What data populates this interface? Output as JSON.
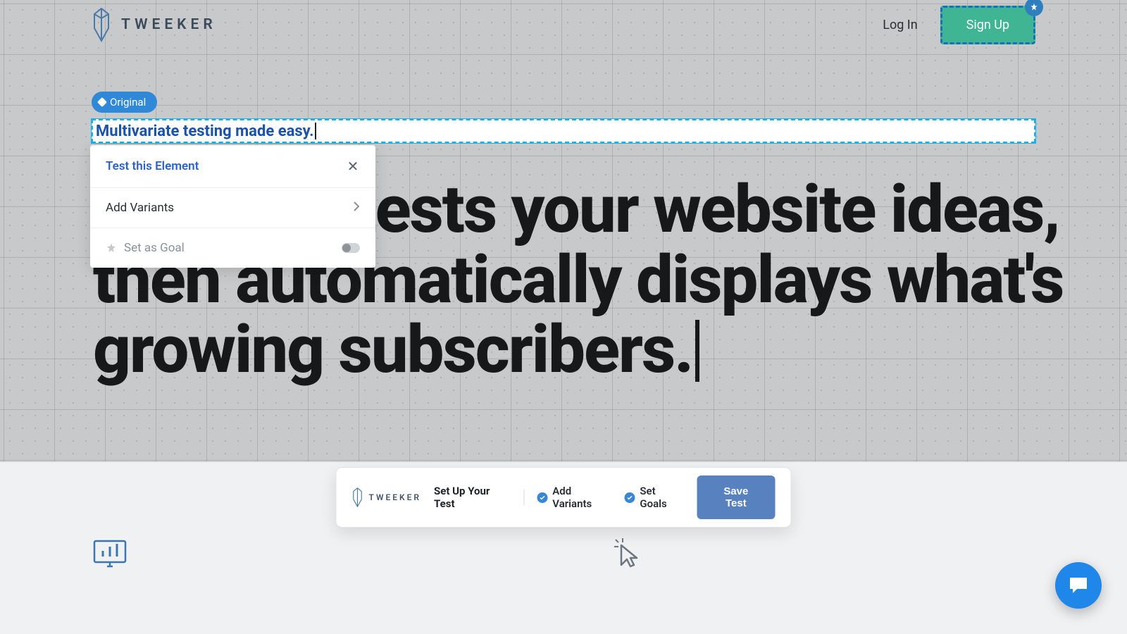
{
  "brand": {
    "name": "TWEEKER"
  },
  "header": {
    "login_label": "Log In",
    "signup_label": "Sign Up"
  },
  "editor": {
    "original_chip": "Original",
    "editable_text": "Multivariate testing made easy."
  },
  "popover": {
    "title": "Test this Element",
    "add_variants": "Add Variants",
    "set_as_goal": "Set as Goal"
  },
  "hero": {
    "line": "Tweeker tests your website ideas, then automatically displays what's growing subscribers."
  },
  "setup_bar": {
    "brand": "TWEEKER",
    "title": "Set Up Your Test",
    "step1": "Add Variants",
    "step2": "Set Goals",
    "save": "Save Test"
  },
  "colors": {
    "accent_blue": "#2f88d8",
    "brand_green": "#3fb593",
    "fab_blue": "#1f86ea"
  }
}
